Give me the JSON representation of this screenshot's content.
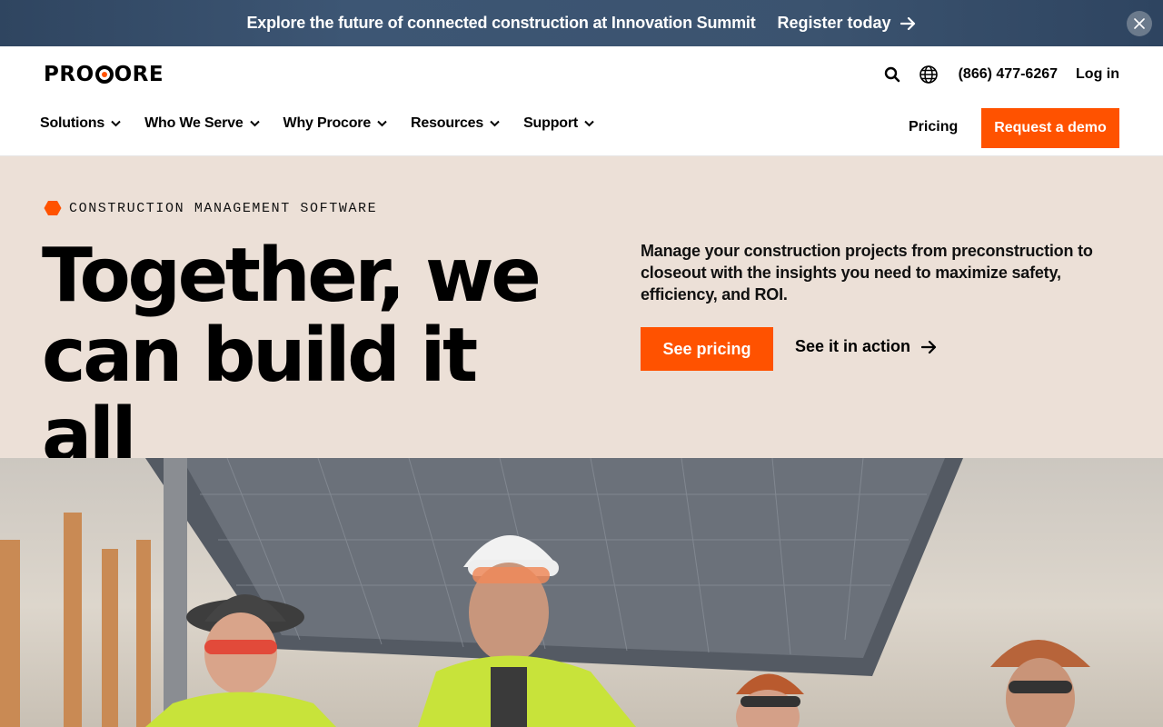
{
  "announcement": {
    "message": "Explore the future of connected construction at Innovation Summit",
    "cta": "Register today",
    "close_icon": "close-icon"
  },
  "header": {
    "logo": "PROCORE",
    "search_icon": "search-icon",
    "language_icon": "globe-icon",
    "phone": "(866) 477-6267",
    "login": "Log in"
  },
  "nav": {
    "items": [
      {
        "label": "Solutions"
      },
      {
        "label": "Who We Serve"
      },
      {
        "label": "Why Procore"
      },
      {
        "label": "Resources"
      },
      {
        "label": "Support"
      }
    ],
    "pricing": "Pricing",
    "demo": "Request a demo"
  },
  "hero": {
    "eyebrow": "CONSTRUCTION MANAGEMENT SOFTWARE",
    "headline_line1": "Together, we",
    "headline_line2": "can build it all",
    "description": "Manage your construction projects from preconstruction to closeout with the insights you need to maximize safety, efficiency, and ROI.",
    "primary_cta": "See pricing",
    "secondary_cta": "See it in action"
  },
  "colors": {
    "brand_orange": "#ff5200",
    "announce_bg": "#3b536f",
    "hero_bg": "#ece0d7"
  }
}
